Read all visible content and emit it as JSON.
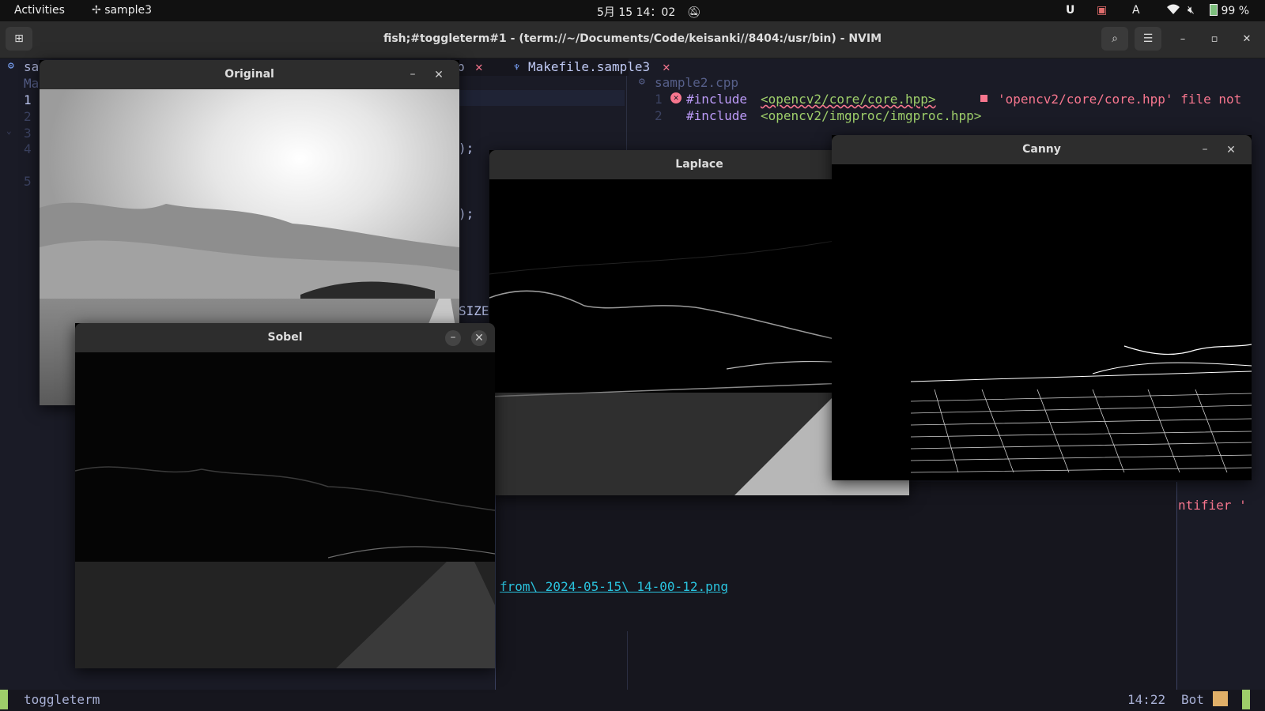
{
  "topbar": {
    "activities": "Activities",
    "app_name": "sample3",
    "datetime": "5月 15 14：02",
    "keyboard": "A",
    "battery": "99 %"
  },
  "window": {
    "title": "fish;#toggleterm#1 - (term://~/Documents/Code/keisanki//8404:/usr/bin) - NVIM"
  },
  "editor": {
    "left_tab_fragment": "sa",
    "left_tab_fragment2": "Ma",
    "line_numbers": [
      "1",
      "2",
      "3",
      "4",
      "5"
    ],
    "tab_partial": "p",
    "tab_makefile": "Makefile.sample3",
    "buffer_name": "sample2.cpp",
    "code_lines": [
      {
        "num": "1",
        "text": "#include",
        "arg": "<opencv2/core/core.hpp>"
      },
      {
        "num": "2",
        "text": "#include",
        "arg": "<opencv2/imgproc/imgproc.hpp>"
      }
    ],
    "diagnostic": "'opencv2/core/core.hpp' file not",
    "frag_paren1": ");",
    "frag_paren2": ");",
    "frag_size": "SIZE",
    "frag_identifier": "ntifier '",
    "link_text": "from\\ 2024-05-15\\ 14-00-12.png"
  },
  "statusline": {
    "mode": "toggleterm",
    "position": "14:22",
    "scroll": "Bot"
  },
  "windows": {
    "original": "Original",
    "laplace": "Laplace",
    "canny": "Canny",
    "sobel": "Sobel"
  },
  "colors": {
    "keyword": "#bb9af7",
    "string": "#9ece6a",
    "error": "#f7768e",
    "link": "#2ac3de",
    "linenr": "#3b4261",
    "mode_green": "#9ece6a",
    "accent_yellow": "#e0af68"
  }
}
